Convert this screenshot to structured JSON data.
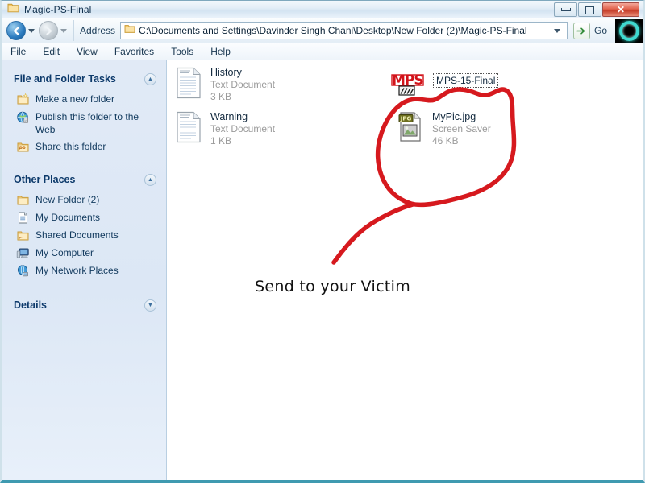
{
  "window": {
    "title": "Magic-PS-Final",
    "title_icon": "folder-icon",
    "controls": {
      "minimize": "minimize-button",
      "maximize": "maximize-button",
      "close": "close-button",
      "close_glyph": "✕"
    }
  },
  "toolbar": {
    "back_icon": "back-arrow-icon",
    "back_glyph": "←",
    "forward_icon": "forward-arrow-icon",
    "forward_glyph": "→",
    "address_label": "Address",
    "address_value": "C:\\Documents and Settings\\Davinder Singh Chani\\Desktop\\New Folder (2)\\Magic-PS-Final",
    "go_label": "Go",
    "go_glyph": "➜",
    "brand_icon": "teal-ring-logo"
  },
  "menu": {
    "items": [
      {
        "label": "File"
      },
      {
        "label": "Edit"
      },
      {
        "label": "View"
      },
      {
        "label": "Favorites"
      },
      {
        "label": "Tools"
      },
      {
        "label": "Help"
      }
    ]
  },
  "sidebar": {
    "panels": [
      {
        "title": "File and Folder Tasks",
        "collapse_glyph": "▲",
        "items": [
          {
            "label": "Make a new folder",
            "icon": "new-folder-icon"
          },
          {
            "label": "Publish this folder to the Web",
            "icon": "publish-web-icon"
          },
          {
            "label": "Share this folder",
            "icon": "share-folder-icon"
          }
        ]
      },
      {
        "title": "Other Places",
        "collapse_glyph": "▲",
        "items": [
          {
            "label": "New Folder (2)",
            "icon": "folder-icon"
          },
          {
            "label": "My Documents",
            "icon": "documents-icon"
          },
          {
            "label": "Shared Documents",
            "icon": "shared-folder-icon"
          },
          {
            "label": "My Computer",
            "icon": "computer-icon"
          },
          {
            "label": "My Network Places",
            "icon": "network-icon"
          }
        ]
      },
      {
        "title": "Details",
        "collapse_glyph": "▼",
        "items": []
      }
    ]
  },
  "files": [
    {
      "name": "History",
      "type": "Text Document",
      "size": "3 KB",
      "icon": "text-document-icon"
    },
    {
      "name": "Warning",
      "type": "Text Document",
      "size": "1 KB",
      "icon": "text-document-icon"
    },
    {
      "name": "MyPic.jpg",
      "type": "Screen Saver",
      "size": "46 KB",
      "icon": "jpg-file-icon"
    }
  ],
  "overlay": {
    "mps_logo_text": "MPS",
    "mps_logo_icon": "mps-red-logo",
    "selected_label": "MPS-15-Final",
    "annotation_text": "Send to your Victim",
    "annotation_color": "#d6191e"
  },
  "colors": {
    "accent": "#d6191e",
    "sidebar_bg": "#dce7f5",
    "sidebar_heading": "#0d3a6b",
    "file_meta": "#9b9b9b",
    "window_border": "#3f9ab0",
    "close_button": "#c33a26",
    "brand_ring": "#3fd8cf"
  }
}
